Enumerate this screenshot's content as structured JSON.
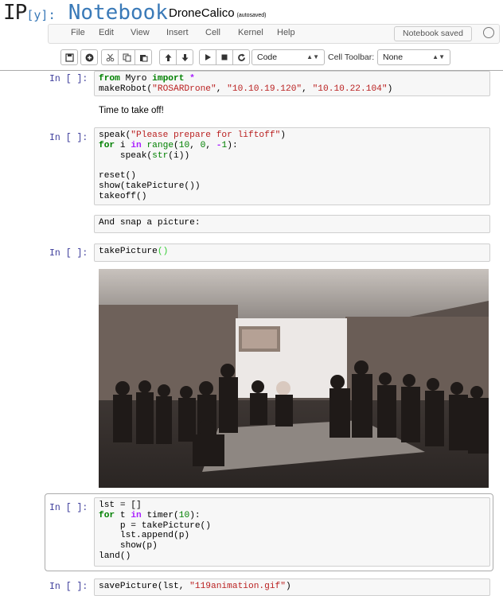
{
  "header": {
    "logo_ip": "IP",
    "logo_y": "[y]",
    "logo_colon": ":",
    "logo_notebook": "Notebook",
    "notebook_name": "DroneCalico",
    "autosave_status": "(autosaved)"
  },
  "menubar": {
    "items": [
      "File",
      "Edit",
      "View",
      "Insert",
      "Cell",
      "Kernel",
      "Help"
    ],
    "save_status": "Notebook saved"
  },
  "toolbar": {
    "cell_type": "Code",
    "cell_toolbar_label": "Cell Toolbar:",
    "cell_toolbar_value": "None"
  },
  "cells": {
    "c1": {
      "prompt": "In [ ]:",
      "line1_a": "from",
      "line1_b": " Myro ",
      "line1_c": "import",
      "line1_d": " *",
      "line2_a": "makeRobot(",
      "line2_b": "\"ROSARDrone\"",
      "line2_c": ", ",
      "line2_d": "\"10.10.19.120\"",
      "line2_e": ", ",
      "line2_f": "\"10.10.22.104\"",
      "line2_g": ")"
    },
    "md1": {
      "text": "Time to take off!"
    },
    "c2": {
      "prompt": "In [ ]:",
      "l1_a": "speak(",
      "l1_b": "\"Please prepare for liftoff\"",
      "l1_c": ")",
      "l2_a": "for",
      "l2_b": " i ",
      "l2_c": "in",
      "l2_d": " ",
      "l2_e": "range",
      "l2_f": "(",
      "l2_g": "10",
      "l2_h": ", ",
      "l2_i": "0",
      "l2_j": ", ",
      "l2_k": "-",
      "l2_l": "1",
      "l2_m": "):",
      "l3_a": "    speak(",
      "l3_b": "str",
      "l3_c": "(i))",
      "l5": "reset()",
      "l6": "show(takePicture())",
      "l7": "takeoff()"
    },
    "md2": {
      "text": "And snap a picture:"
    },
    "c3": {
      "prompt": "In [ ]:",
      "code_a": "takePicture",
      "code_b": "()"
    },
    "c4": {
      "prompt": "In [ ]:",
      "l1": "lst = []",
      "l2_a": "for",
      "l2_b": " t ",
      "l2_c": "in",
      "l2_d": " timer(",
      "l2_e": "10",
      "l2_f": "):",
      "l3": "    p = takePicture()",
      "l4": "    lst.append(p)",
      "l5": "    show(p)",
      "l6": "land()"
    },
    "c5": {
      "prompt": "In [ ]:",
      "code_a": "savePicture(lst, ",
      "code_b": "\"119animation.gif\"",
      "code_c": ")"
    }
  }
}
